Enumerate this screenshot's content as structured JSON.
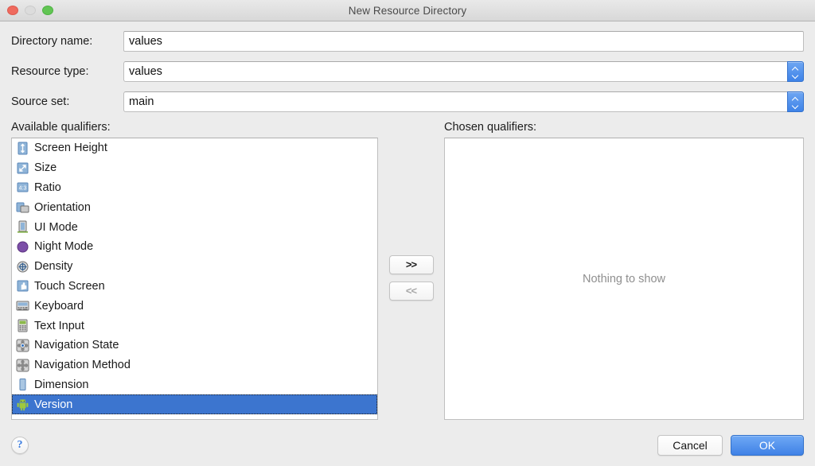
{
  "window": {
    "title": "New Resource Directory",
    "traffic_lights": [
      "close-button",
      "minimize-button",
      "maximize-button"
    ]
  },
  "form": {
    "rows": [
      {
        "label": "Directory name:",
        "value": "values",
        "type": "text"
      },
      {
        "label": "Resource type:",
        "value": "values",
        "type": "combo"
      },
      {
        "label": "Source set:",
        "value": "main",
        "type": "combo"
      }
    ]
  },
  "available": {
    "label": "Available qualifiers:",
    "items": [
      {
        "label": "Screen Height",
        "icon": "screen-height-icon",
        "selected": false
      },
      {
        "label": "Size",
        "icon": "size-icon",
        "selected": false
      },
      {
        "label": "Ratio",
        "icon": "ratio-icon",
        "selected": false
      },
      {
        "label": "Orientation",
        "icon": "orientation-icon",
        "selected": false
      },
      {
        "label": "UI Mode",
        "icon": "ui-mode-icon",
        "selected": false
      },
      {
        "label": "Night Mode",
        "icon": "night-mode-icon",
        "selected": false
      },
      {
        "label": "Density",
        "icon": "density-icon",
        "selected": false
      },
      {
        "label": "Touch Screen",
        "icon": "touch-screen-icon",
        "selected": false
      },
      {
        "label": "Keyboard",
        "icon": "keyboard-icon",
        "selected": false
      },
      {
        "label": "Text Input",
        "icon": "text-input-icon",
        "selected": false
      },
      {
        "label": "Navigation State",
        "icon": "navigation-state-icon",
        "selected": false
      },
      {
        "label": "Navigation Method",
        "icon": "navigation-method-icon",
        "selected": false
      },
      {
        "label": "Dimension",
        "icon": "dimension-icon",
        "selected": false
      },
      {
        "label": "Version",
        "icon": "android-version-icon",
        "selected": true
      }
    ]
  },
  "transfer": {
    "add_label": ">>",
    "remove_label": "<<",
    "add_enabled": true,
    "remove_enabled": false
  },
  "chosen": {
    "label": "Chosen qualifiers:",
    "empty_message": "Nothing to show",
    "items": []
  },
  "footer": {
    "help_label": "?",
    "cancel_label": "Cancel",
    "ok_label": "OK"
  },
  "colors": {
    "selection_blue": "#3c75cf",
    "default_button_blue": "#3f81e6",
    "stepper_blue": "#3e83e8",
    "help_blue": "#3b7ce0",
    "window_bg": "#ececec",
    "placeholder_gray": "#8f8f8f"
  }
}
